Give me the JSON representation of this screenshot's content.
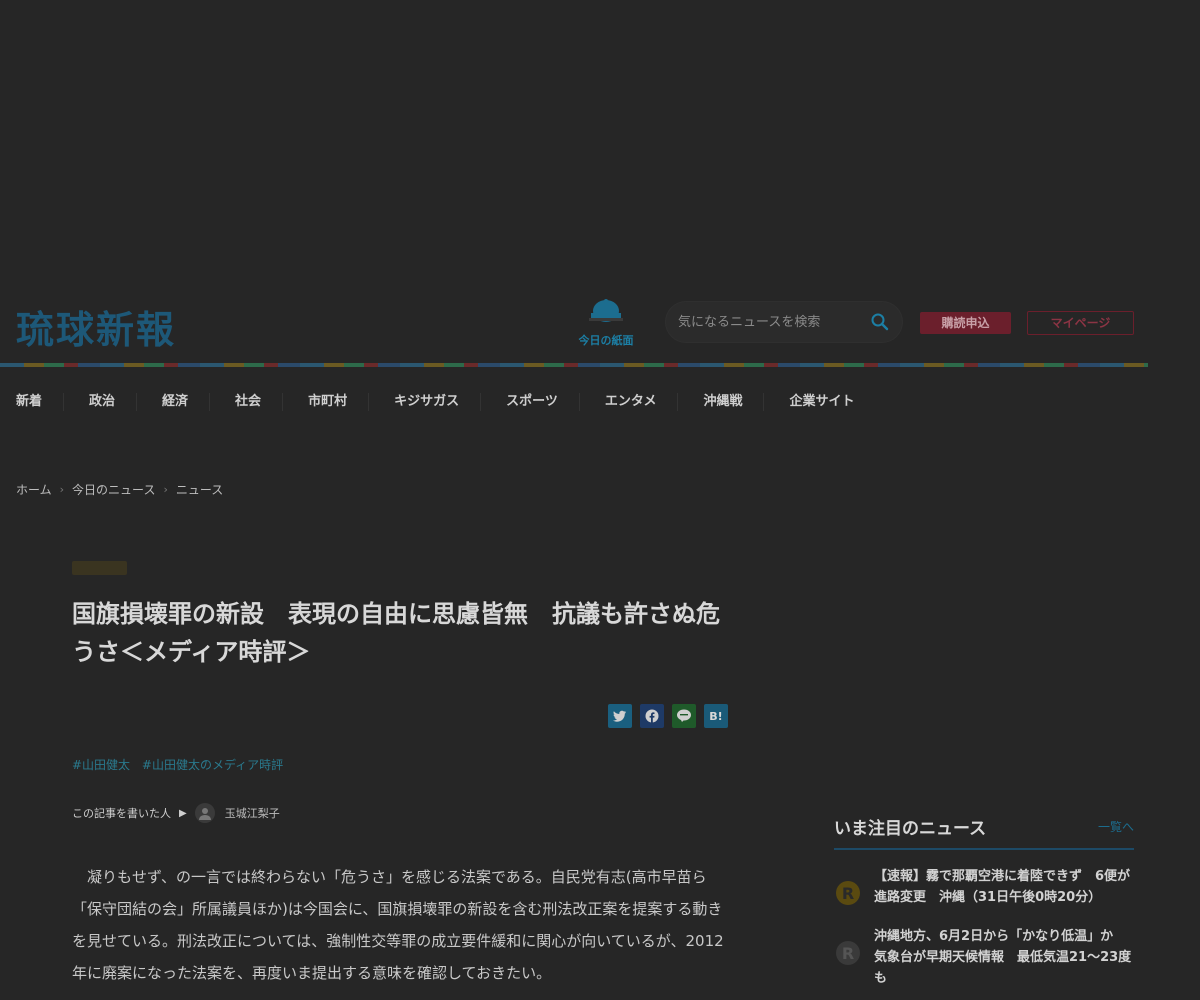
{
  "header": {
    "logo_text": "琉球新報",
    "todays_paper_label": "今日の紙面",
    "search_placeholder": "気になるニュースを検索",
    "subscribe_label": "購読申込",
    "mypage_label": "マイページ"
  },
  "nav": {
    "items": [
      "新着",
      "政治",
      "経済",
      "社会",
      "市町村",
      "キジサガス",
      "スポーツ",
      "エンタメ",
      "沖縄戦",
      "企業サイト"
    ]
  },
  "breadcrumb": {
    "items": [
      "ホーム",
      "今日のニュース",
      "ニュース"
    ]
  },
  "article": {
    "badge": "",
    "headline": "国旗損壊罪の新設　表現の自由に思慮皆無　抗議も許さぬ危うさ＜メディア時評＞",
    "published": "",
    "updated": "",
    "share": {
      "twitter_icon": "twitter-icon",
      "facebook_icon": "facebook-icon",
      "line_icon": "line-icon",
      "hatena_label": "B!"
    },
    "tags": [
      "#山田健太",
      "#山田健太のメディア時評"
    ],
    "author_prefix": "この記事を書いた人",
    "author_arrow": "▶",
    "author_name": "玉城江梨子",
    "body": "凝りもせず、の一言では終わらない「危うさ」を感じる法案である。自民党有志(高市早苗ら「保守団結の会」所属議員ほか)は今国会に、国旗損壊罪の新設を含む刑法改正案を提案する動きを見せている。刑法改正については、強制性交等罪の成立要件緩和に関心が向いているが、2012年に廃案になった法案を、再度いま提出する意味を確認しておきたい。"
  },
  "sidebar": {
    "title": "いま注目のニュース",
    "more_label": "一覧へ",
    "items": [
      "【速報】霧で那覇空港に着陸できず　6便が進路変更　沖縄（31日午後0時20分）",
      "沖縄地方、6月2日から「かなり低温」か　気象台が早期天候情報　最低気温21～23度も"
    ]
  },
  "colors": {
    "background": "#262626",
    "logo": "#1d5878",
    "accent_blue": "#1c7fa5",
    "accent_red": "#6b1f2c"
  }
}
